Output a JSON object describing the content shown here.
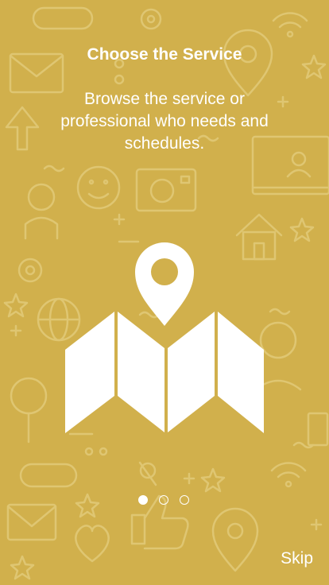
{
  "onboarding": {
    "title": "Choose the Service",
    "description": "Browse the service or professional who needs and schedules.",
    "skip_label": "Skip",
    "page_indicator": {
      "total": 3,
      "current": 1
    },
    "hero_icon": "map-pin-icon"
  },
  "colors": {
    "background": "#d1b04c",
    "pattern": "#dfc672",
    "foreground": "#ffffff"
  }
}
